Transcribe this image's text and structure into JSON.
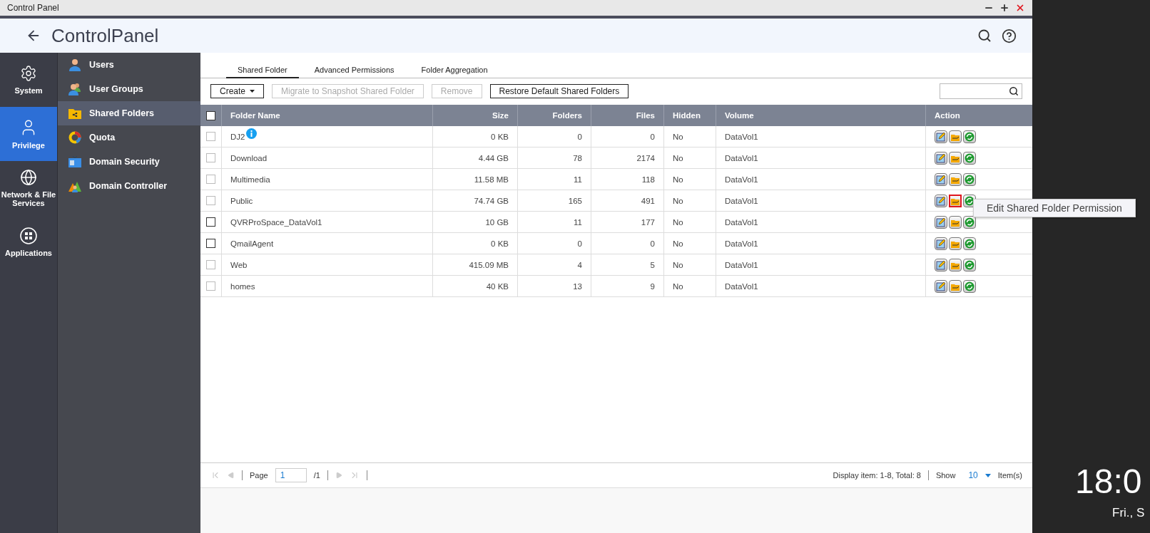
{
  "window": {
    "title": "Control Panel"
  },
  "header": {
    "title": "**Control**Panel"
  },
  "rail": [
    {
      "label": "System",
      "kind": "gear",
      "selected": false
    },
    {
      "label": "Privilege",
      "kind": "user",
      "selected": true
    },
    {
      "label": "Network & File Services",
      "kind": "globe",
      "selected": false
    },
    {
      "label": "Applications",
      "kind": "apps",
      "selected": false
    }
  ],
  "submenu": [
    {
      "label": "Users",
      "kind": "user",
      "selected": false
    },
    {
      "label": "User Groups",
      "kind": "group",
      "selected": false
    },
    {
      "label": "Shared Folders",
      "kind": "folder",
      "selected": true
    },
    {
      "label": "Quota",
      "kind": "quota",
      "selected": false
    },
    {
      "label": "Domain Security",
      "kind": "security",
      "selected": false
    },
    {
      "label": "Domain Controller",
      "kind": "controller",
      "selected": false
    }
  ],
  "tabs": [
    {
      "label": "Shared Folder",
      "selected": true
    },
    {
      "label": "Advanced Permissions",
      "selected": false
    },
    {
      "label": "Folder Aggregation",
      "selected": false
    }
  ],
  "toolbar": [
    {
      "label": "Create",
      "dropdown": true,
      "disabled": false
    },
    {
      "label": "Migrate to Snapshot Shared Folder",
      "dropdown": false,
      "disabled": true
    },
    {
      "label": "Remove",
      "dropdown": false,
      "disabled": true
    },
    {
      "label": "Restore Default Shared Folders",
      "dropdown": false,
      "disabled": false
    }
  ],
  "table": {
    "header_checkbox": {
      "checked": false,
      "disabled": false
    },
    "columns": [
      "Folder Name",
      "Size",
      "Folders",
      "Files",
      "Hidden",
      "Volume",
      "Action"
    ],
    "rows": [
      {
        "name": "DJ2",
        "info": true,
        "size": "0 KB",
        "folders": "0",
        "files": "0",
        "hidden": "No",
        "volume": "DataVol1",
        "checked": false,
        "disabled": true,
        "highlighted": false
      },
      {
        "name": "Download",
        "info": false,
        "size": "4.44 GB",
        "folders": "78",
        "files": "2174",
        "hidden": "No",
        "volume": "DataVol1",
        "checked": false,
        "disabled": true,
        "highlighted": false
      },
      {
        "name": "Multimedia",
        "info": false,
        "size": "11.58 MB",
        "folders": "11",
        "files": "118",
        "hidden": "No",
        "volume": "DataVol1",
        "checked": false,
        "disabled": true,
        "highlighted": false
      },
      {
        "name": "Public",
        "info": false,
        "size": "74.74 GB",
        "folders": "165",
        "files": "491",
        "hidden": "No",
        "volume": "DataVol1",
        "checked": false,
        "disabled": true,
        "highlighted": true,
        "tooltip": "Edit Shared Folder Permission"
      },
      {
        "name": "QVRProSpace_DataVol1",
        "info": false,
        "size": "10 GB",
        "folders": "11",
        "files": "177",
        "hidden": "No",
        "volume": "DataVol1",
        "checked": false,
        "disabled": false,
        "highlighted": false
      },
      {
        "name": "QmailAgent",
        "info": false,
        "size": "0 KB",
        "folders": "0",
        "files": "0",
        "hidden": "No",
        "volume": "DataVol1",
        "checked": false,
        "disabled": false,
        "highlighted": false
      },
      {
        "name": "Web",
        "info": false,
        "size": "415.09 MB",
        "folders": "4",
        "files": "5",
        "hidden": "No",
        "volume": "DataVol1",
        "checked": false,
        "disabled": true,
        "highlighted": false
      },
      {
        "name": "homes",
        "info": false,
        "size": "40 KB",
        "folders": "13",
        "files": "9",
        "hidden": "No",
        "volume": "DataVol1",
        "checked": false,
        "disabled": true,
        "highlighted": false
      }
    ]
  },
  "pager": {
    "page_label": "Page",
    "page": "1",
    "total_pages": "/1",
    "display": "Display item: 1-8, Total: 8",
    "show_label": "Show",
    "show_value": "10",
    "items_label": "Item(s)"
  },
  "desktop": {
    "time": "18:0",
    "date": "Fri., S"
  }
}
